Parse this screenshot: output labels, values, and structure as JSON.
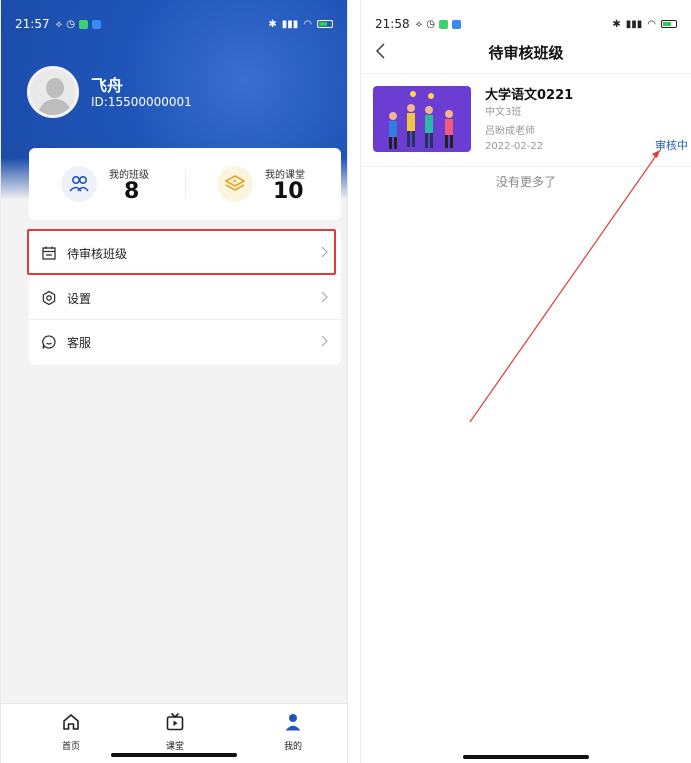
{
  "left": {
    "status": {
      "time": "21:57"
    },
    "profile": {
      "name": "飞舟",
      "id": "ID:15500000001"
    },
    "stats": [
      {
        "label": "我的班级",
        "value": "8"
      },
      {
        "label": "我的课堂",
        "value": "10"
      }
    ],
    "menu": [
      {
        "label": "待审核班级"
      },
      {
        "label": "设置"
      },
      {
        "label": "客服"
      }
    ],
    "tabs": [
      {
        "label": "首页"
      },
      {
        "label": "课堂"
      },
      {
        "label": "我的"
      }
    ],
    "colors": {
      "brand": "#1f55b8",
      "highlight": "#e23a3a"
    }
  },
  "right": {
    "status": {
      "time": "21:58"
    },
    "nav": {
      "title": "待审核班级"
    },
    "class": {
      "name": "大学语文0221",
      "group": "中文3班",
      "teacher": "吕盼成老师",
      "date": "2022-02-22",
      "status": "审核中"
    },
    "footer": "没有更多了",
    "colors": {
      "status": "#2361b8"
    }
  }
}
